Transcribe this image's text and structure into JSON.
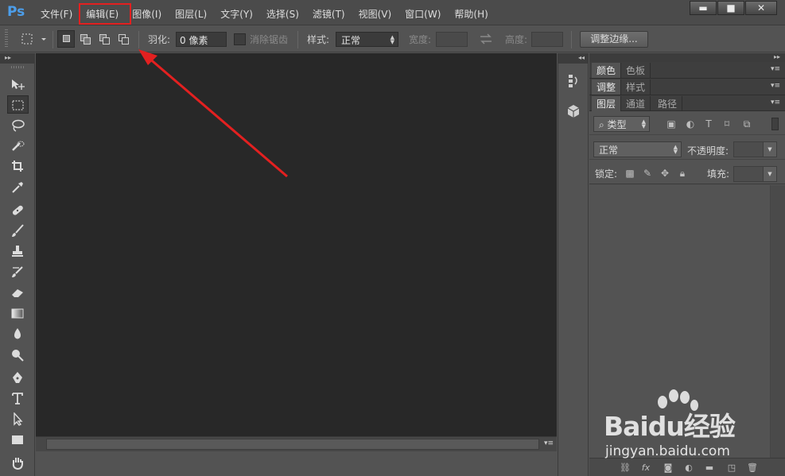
{
  "app": {
    "logo": "Ps"
  },
  "menu": {
    "items": [
      {
        "label": "文件(F)"
      },
      {
        "label": "编辑(E)"
      },
      {
        "label": "图像(I)"
      },
      {
        "label": "图层(L)"
      },
      {
        "label": "文字(Y)"
      },
      {
        "label": "选择(S)"
      },
      {
        "label": "滤镜(T)"
      },
      {
        "label": "视图(V)"
      },
      {
        "label": "窗口(W)"
      },
      {
        "label": "帮助(H)"
      }
    ],
    "highlighted": "编辑(E)"
  },
  "window_controls": {
    "minimize": "▬",
    "maximize": "■",
    "close": "✕"
  },
  "options_bar": {
    "feather_label": "羽化:",
    "feather_value": "0 像素",
    "antialias_label": "消除锯齿",
    "style_label": "样式:",
    "style_value": "正常",
    "width_label": "宽度:",
    "height_label": "高度:",
    "refine_edge_label": "调整边缘..."
  },
  "panels": {
    "group1": {
      "tabs": [
        "颜色",
        "色板"
      ]
    },
    "group2": {
      "tabs": [
        "调整",
        "样式"
      ]
    },
    "group3": {
      "tabs": [
        "图层",
        "通道",
        "路径"
      ]
    },
    "layers": {
      "filter_label": "类型",
      "blend_mode": "正常",
      "opacity_label": "不透明度:",
      "lock_label": "锁定:",
      "fill_label": "填充:"
    }
  },
  "watermark": {
    "brand": "Baidu经验",
    "url": "jingyan.baidu.com"
  },
  "colors": {
    "annotation": "#e32020",
    "ps_blue": "#4c9eea",
    "canvas_bg": "#282828",
    "ui_gray": "#535353"
  },
  "tools": [
    "move-tool-icon",
    "rectangular-marquee-icon",
    "lasso-icon",
    "quick-selection-icon",
    "crop-icon",
    "eyedropper-icon",
    "spot-healing-icon",
    "brush-icon",
    "clone-stamp-icon",
    "history-brush-icon",
    "eraser-icon",
    "gradient-icon",
    "blur-icon",
    "dodge-icon",
    "pen-icon",
    "type-icon",
    "path-selection-icon",
    "rectangle-icon",
    "hand-icon"
  ]
}
